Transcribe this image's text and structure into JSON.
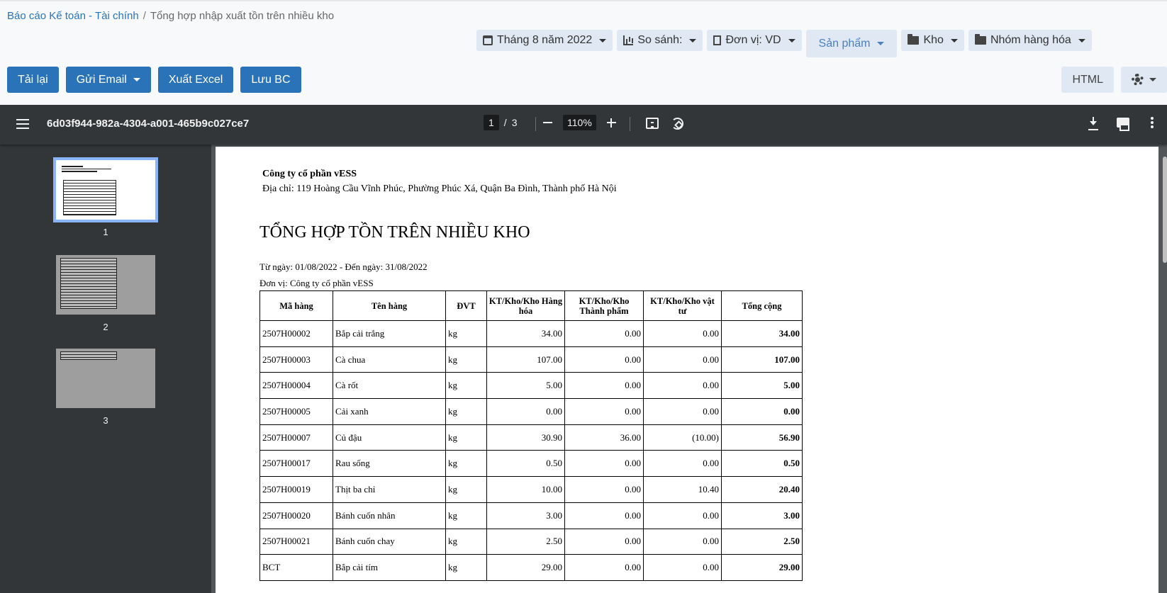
{
  "breadcrumb": {
    "parent": "Báo cáo Kế toán - Tài chính",
    "separator": "/",
    "current": "Tổng hợp nhập xuất tồn trên nhiều kho"
  },
  "filters": {
    "period": "Tháng 8 năm 2022",
    "compare": "So sánh:",
    "unit": "Đơn vị: VD",
    "product": "Sản phẩm",
    "warehouse": "Kho",
    "group": "Nhóm hàng hóa"
  },
  "actions": {
    "reload": "Tải lại",
    "send_email": "Gửi Email",
    "export_excel": "Xuất Excel",
    "save": "Lưu BC",
    "html": "HTML"
  },
  "viewer": {
    "doc_name": "6d03f944-982a-4304-a001-465b9c027ce7",
    "current_page": "1",
    "page_sep": "/",
    "total_pages": "3",
    "zoom": "110%",
    "thumbnails": [
      "1",
      "2",
      "3"
    ]
  },
  "report": {
    "company": "Công ty cổ phần vESS",
    "address": "Địa chỉ: 119 Hoàng Cầu Vĩnh Phúc, Phường Phúc Xá, Quận Ba Đình, Thành phố Hà Nội",
    "title": "TỔNG HỢP TỒN TRÊN NHIỀU KHO",
    "date_range": "Từ ngày: 01/08/2022 - Đến ngày: 31/08/2022",
    "unit": "Đơn vị: Công ty cổ phần vESS",
    "columns": [
      "Mã hàng",
      "Tên hàng",
      "ĐVT",
      "KT/Kho/Kho Hàng hóa",
      "KT/Kho/Kho Thành phẩm",
      "KT/Kho/Kho vật tư",
      "Tổng cộng"
    ],
    "rows": [
      [
        "2507H00002",
        "Bắp cải trắng",
        "kg",
        "34.00",
        "0.00",
        "0.00",
        "34.00"
      ],
      [
        "2507H00003",
        "Cà chua",
        "kg",
        "107.00",
        "0.00",
        "0.00",
        "107.00"
      ],
      [
        "2507H00004",
        "Cà rốt",
        "kg",
        "5.00",
        "0.00",
        "0.00",
        "5.00"
      ],
      [
        "2507H00005",
        "Cải xanh",
        "kg",
        "0.00",
        "0.00",
        "0.00",
        "0.00"
      ],
      [
        "2507H00007",
        "Củ đậu",
        "kg",
        "30.90",
        "36.00",
        "(10.00)",
        "56.90"
      ],
      [
        "2507H00017",
        "Rau sống",
        "kg",
        "0.50",
        "0.00",
        "0.00",
        "0.50"
      ],
      [
        "2507H00019",
        "Thịt ba chỉ",
        "kg",
        "10.00",
        "0.00",
        "10.40",
        "20.40"
      ],
      [
        "2507H00020",
        "Bánh cuốn nhân",
        "kg",
        "3.00",
        "0.00",
        "0.00",
        "3.00"
      ],
      [
        "2507H00021",
        "Bánh cuốn chay",
        "kg",
        "2.50",
        "0.00",
        "0.00",
        "2.50"
      ],
      [
        "BCT",
        "Bắp cải tím",
        "kg",
        "29.00",
        "0.00",
        "0.00",
        "29.00"
      ]
    ]
  },
  "colors": {
    "primary": "#2a73b8",
    "filter_bg": "#dfe8f3",
    "viewer_bg": "#323639",
    "doc_bg": "#525659",
    "thumb_selected": "#8ab4f8"
  }
}
